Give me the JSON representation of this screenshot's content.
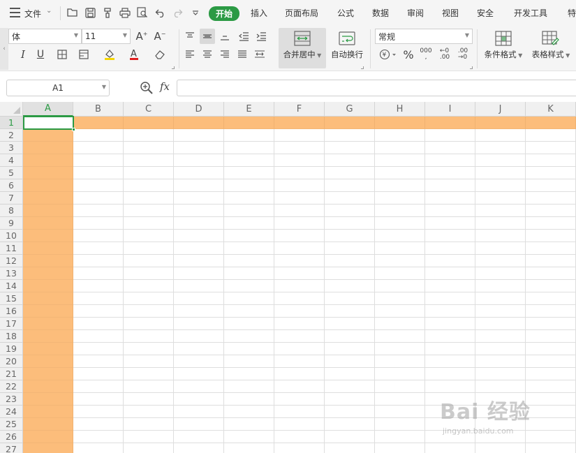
{
  "menu": {
    "file_label": "文件",
    "quick_access": [
      "open-folder-icon",
      "save-icon",
      "format-painter-icon",
      "print-icon",
      "print-preview-icon",
      "undo-icon",
      "redo-icon",
      "more-icon"
    ],
    "tabs": [
      {
        "label": "开始",
        "active": true
      },
      {
        "label": "插入"
      },
      {
        "label": "页面布局"
      },
      {
        "label": "公式"
      },
      {
        "label": "数据"
      },
      {
        "label": "审阅"
      },
      {
        "label": "视图"
      },
      {
        "label": "安全"
      },
      {
        "label": "开发工具"
      },
      {
        "label": "特"
      }
    ]
  },
  "ribbon": {
    "font_name": "体",
    "font_size": "11",
    "merge_label": "合并居中",
    "wrap_label": "自动换行",
    "number_format": "常规",
    "conditional_label": "条件格式",
    "table_style_label": "表格样式",
    "font_color": "#e02020",
    "fill_color": "#f5d600"
  },
  "formula_bar": {
    "name_box": "A1",
    "fx_label": "fx",
    "formula": ""
  },
  "sheet": {
    "columns": [
      "A",
      "B",
      "C",
      "D",
      "E",
      "F",
      "G",
      "H",
      "I",
      "J",
      "K"
    ],
    "rows": [
      "1",
      "2",
      "3",
      "4",
      "5",
      "6",
      "7",
      "8",
      "9",
      "10",
      "11",
      "12",
      "13",
      "14",
      "15",
      "16",
      "17",
      "18",
      "19",
      "20",
      "21",
      "22",
      "23",
      "24",
      "25",
      "26",
      "27"
    ],
    "selected_column": "A",
    "selected_row": "1",
    "fill_color": "#fcbd7b",
    "accent_color": "#2b9a44"
  },
  "watermark": {
    "main": "Bai 经验",
    "sub": "jingyan.baidu.com"
  }
}
